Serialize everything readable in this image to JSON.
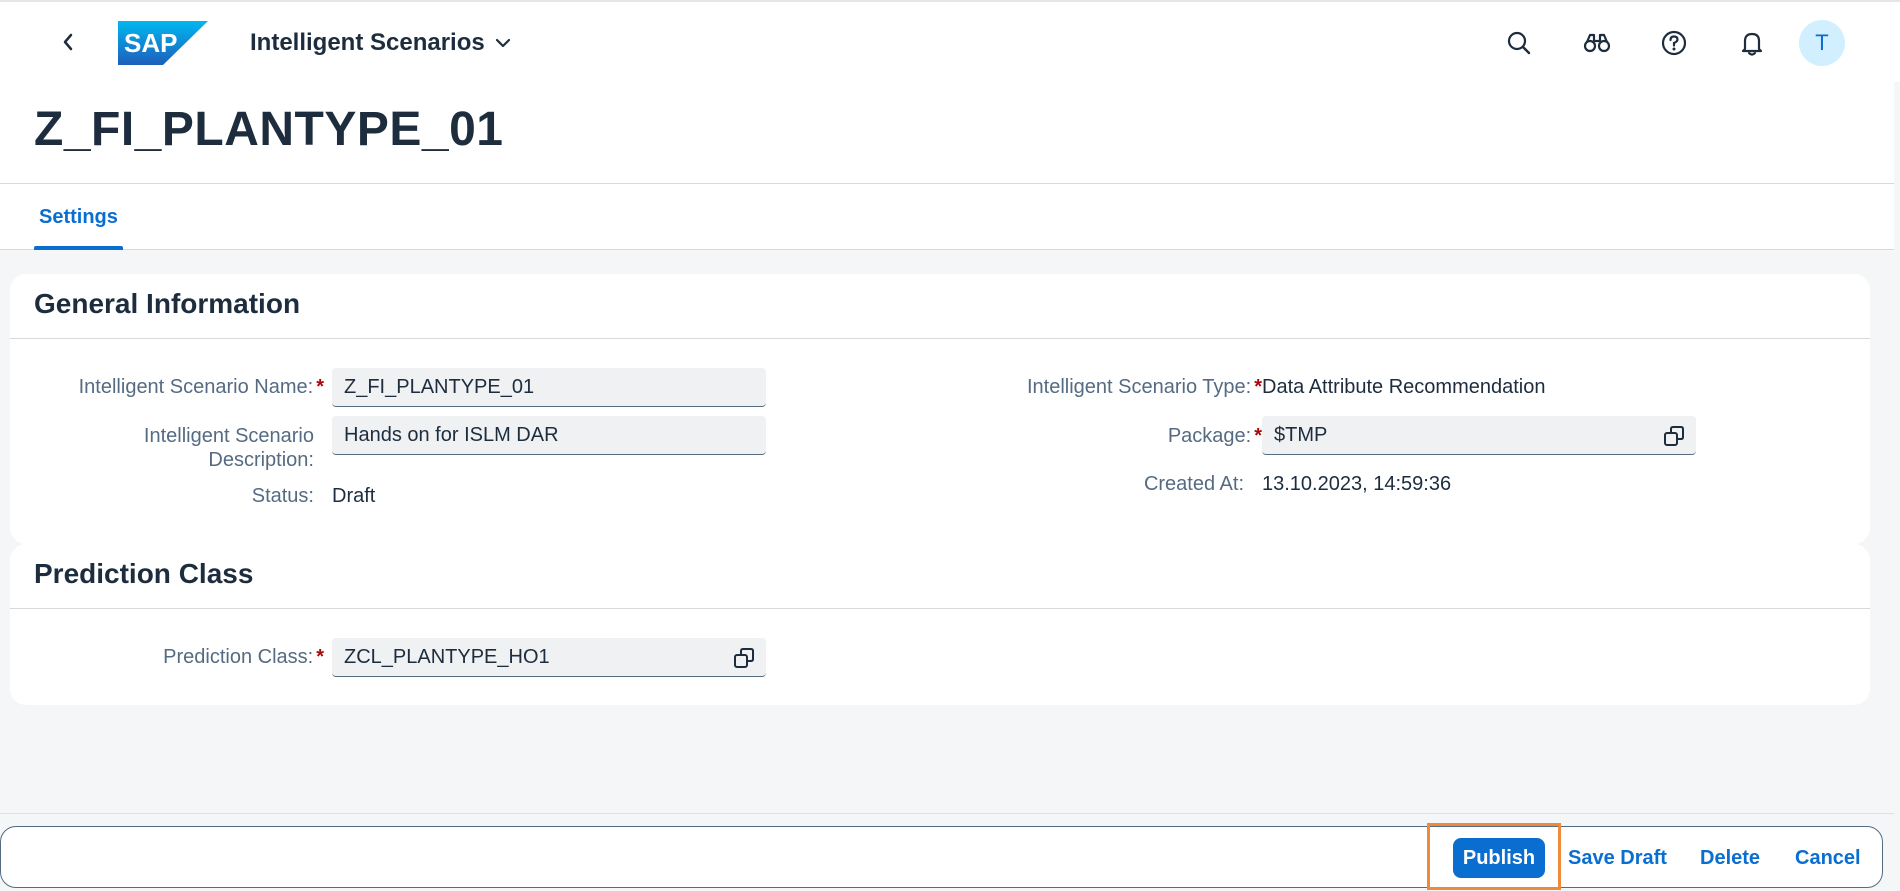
{
  "shellbar": {
    "logo_text": "SAP",
    "app_title": "Intelligent Scenarios",
    "avatar_initial": "T",
    "icons": [
      "back-icon",
      "search-icon",
      "binoculars-icon",
      "help-icon",
      "bell-icon",
      "chevron-down-icon"
    ]
  },
  "header": {
    "title": "Z_FI_PLANTYPE_01"
  },
  "tabs": [
    {
      "label": "Settings",
      "selected": true
    }
  ],
  "general": {
    "title": "General Information",
    "name_label": "Intelligent Scenario Name:",
    "name_value": "Z_FI_PLANTYPE_01",
    "desc_label_line1": "Intelligent Scenario",
    "desc_label_line2": "Description:",
    "desc_value": "Hands on for ISLM DAR",
    "status_label": "Status:",
    "status_value": "Draft",
    "type_label": "Intelligent Scenario Type:",
    "type_value": "Data Attribute Recommendation",
    "package_label": "Package:",
    "package_value": "$TMP",
    "created_label": "Created At:",
    "created_value": "13.10.2023, 14:59:36",
    "required_marker": "*"
  },
  "prediction": {
    "title": "Prediction Class",
    "class_label": "Prediction Class:",
    "class_value": "ZCL_PLANTYPE_HO1"
  },
  "footer": {
    "publish": "Publish",
    "save_draft": "Save Draft",
    "delete": "Delete",
    "cancel": "Cancel"
  },
  "colors": {
    "brand": "#0a6ed1",
    "required": "#aa0808",
    "highlight": "#ee8a3c"
  }
}
